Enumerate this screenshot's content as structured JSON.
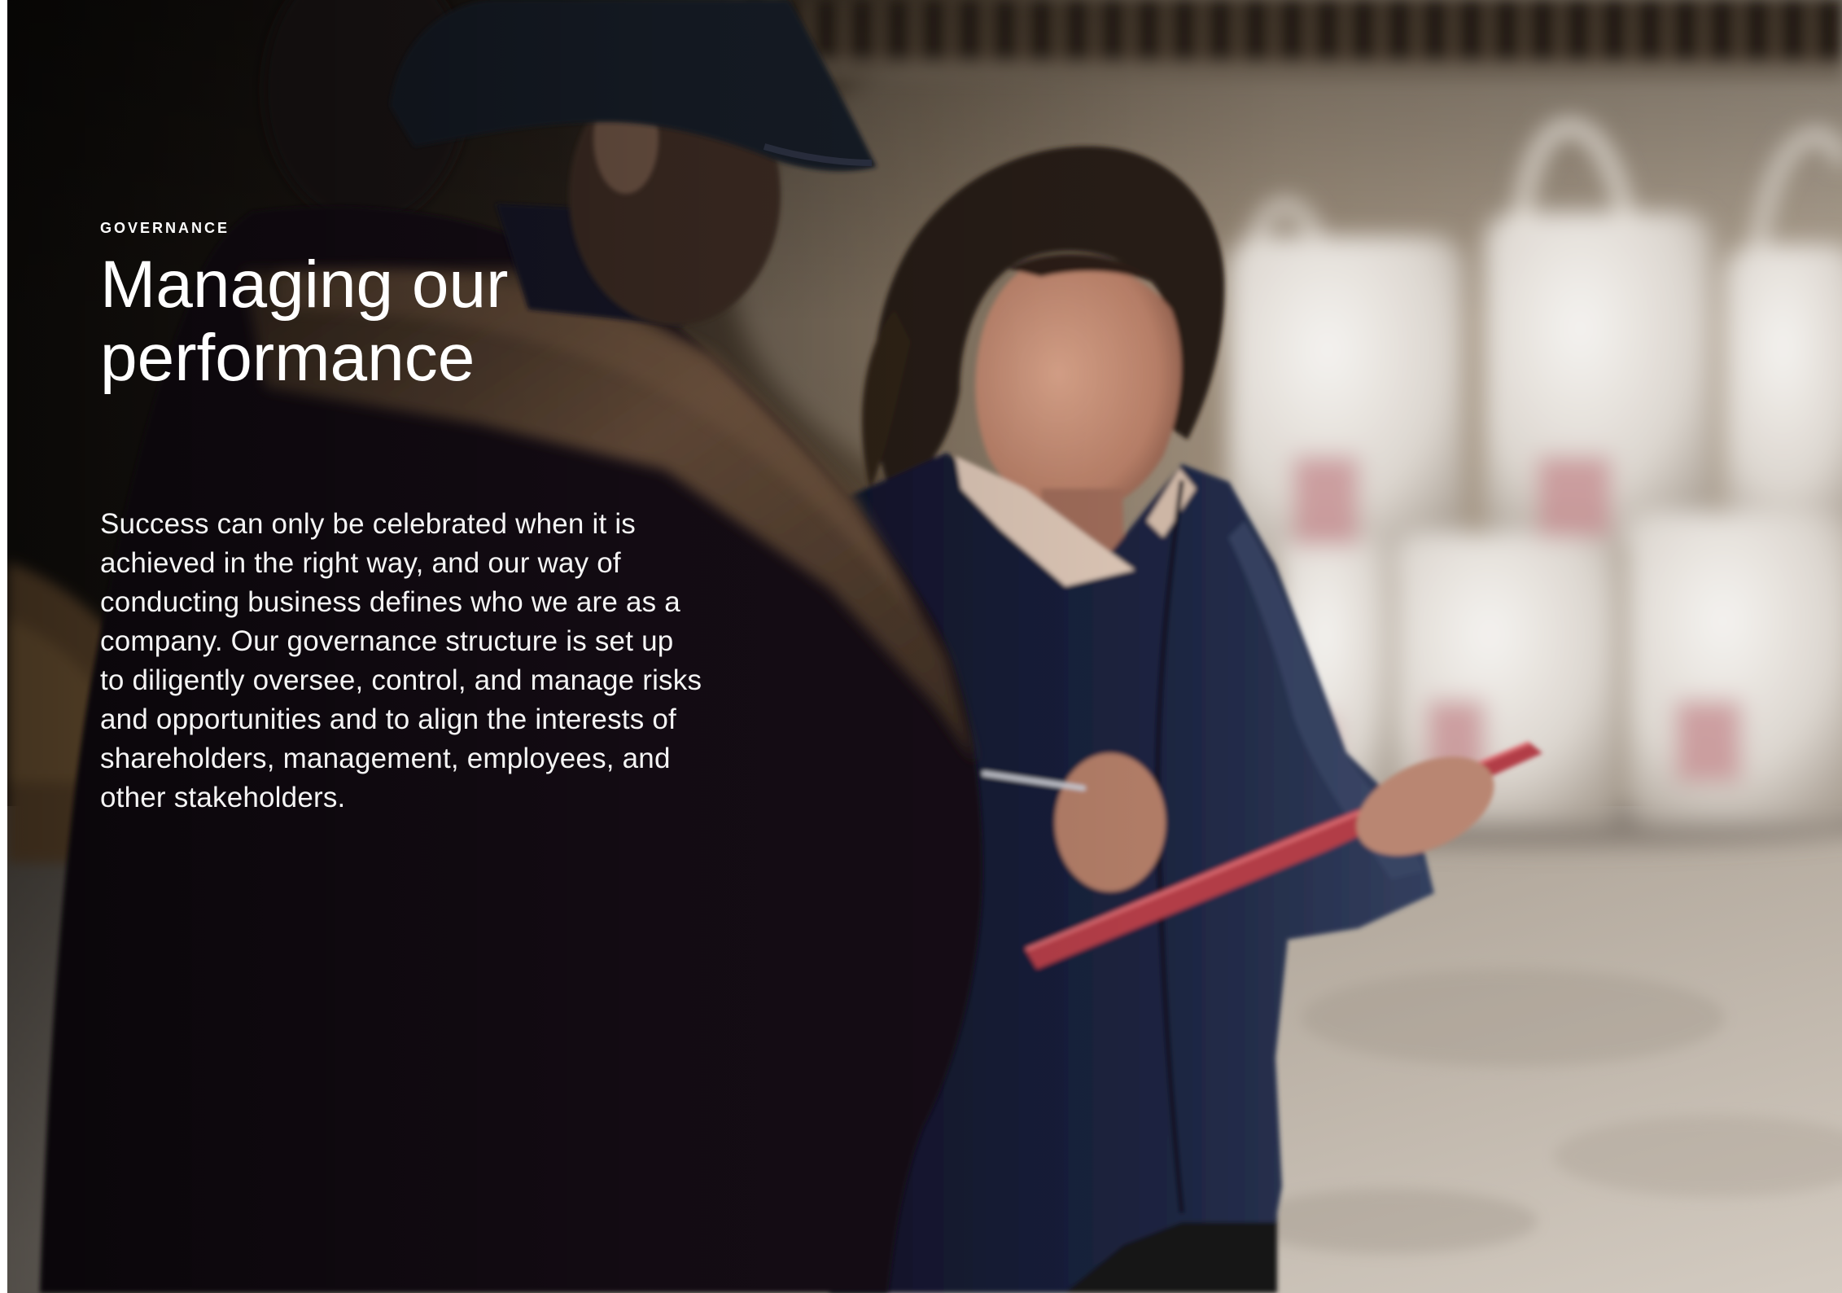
{
  "section_label": "GOVERNANCE",
  "title": {
    "lines": [
      "Managing our",
      "performance"
    ]
  },
  "body": {
    "lines": [
      "Success can only be celebrated when it is",
      "achieved in the right way, and our way of",
      "conducting business defines who we are as a",
      "company. Our governance structure is set up",
      "to diligently oversee, control, and manage risks",
      "and opportunities and to align the interests of",
      "shareholders, management, employees, and",
      "other stakeholders."
    ]
  },
  "colors": {
    "text": "#ffffff",
    "page_background": "#ffffff"
  }
}
